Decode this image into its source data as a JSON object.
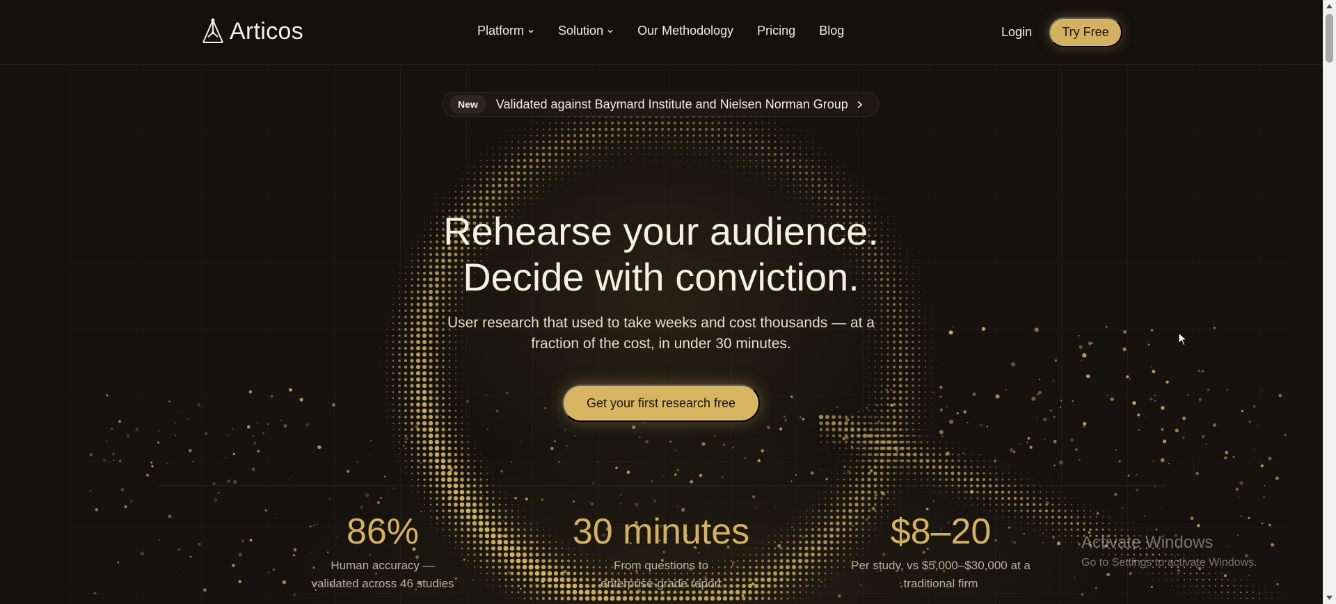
{
  "brand": {
    "name": "Articos",
    "accent": "#d4b15e"
  },
  "nav": {
    "items": [
      {
        "label": "Platform",
        "has_dropdown": true
      },
      {
        "label": "Solution",
        "has_dropdown": true
      },
      {
        "label": "Our Methodology",
        "has_dropdown": false
      },
      {
        "label": "Pricing",
        "has_dropdown": false
      },
      {
        "label": "Blog",
        "has_dropdown": false
      }
    ],
    "login": "Login",
    "cta": "Try Free"
  },
  "announcement": {
    "badge": "New",
    "text": "Validated against Baymard Institute and Nielsen Norman Group"
  },
  "hero": {
    "title_line1": "Rehearse your audience.",
    "title_line2": "Decide with conviction.",
    "subtitle": "User research that used to take weeks and cost thousands — at a fraction of the cost, in under 30 minutes.",
    "cta": "Get your first research free"
  },
  "stats": [
    {
      "value": "86%",
      "label": "Human accuracy — validated across 46 studies"
    },
    {
      "value": "30 minutes",
      "label": "From questions to enterprise-grade report"
    },
    {
      "value": "$8–20",
      "label": "Per study, vs $5,000–$30,000 at a traditional firm"
    }
  ],
  "watermark": {
    "title": "Activate Windows",
    "subtitle": "Go to Settings to activate Windows."
  },
  "icons": {
    "logo": "triangle-node-icon",
    "dropdown": "chevron-down-icon",
    "announce": "chevron-right-icon"
  }
}
